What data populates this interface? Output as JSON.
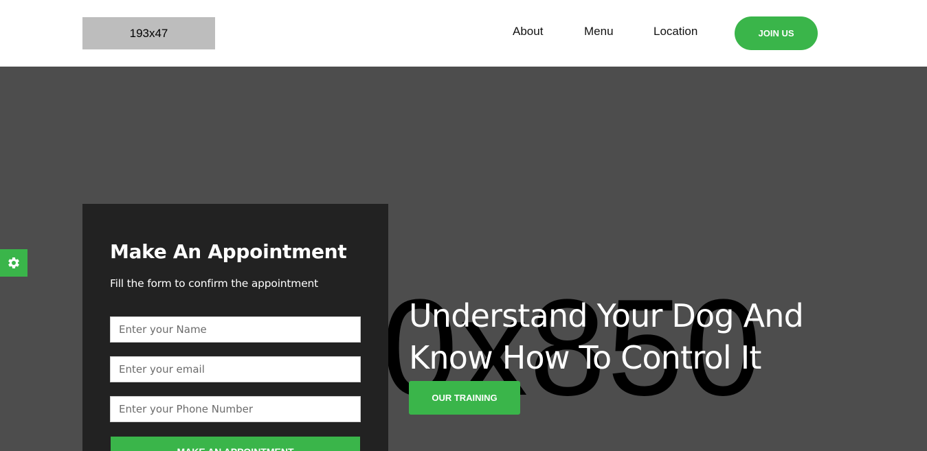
{
  "header": {
    "logo_text": "193x47",
    "nav": {
      "about": "About",
      "menu": "Menu",
      "location": "Location"
    },
    "join_label": "JOIN US"
  },
  "hero": {
    "placeholder_text": "0x850",
    "heading_line1": "Understand Your Dog And",
    "heading_line2": "Know How To Control It",
    "training_label": "OUR TRAINING"
  },
  "settings": {
    "icon": "gear-icon"
  },
  "appointment": {
    "title": "Make An Appointment",
    "subtitle": "Fill the form to confirm the appointment",
    "name_placeholder": "Enter your Name",
    "email_placeholder": "Enter your email",
    "phone_placeholder": "Enter your Phone Number",
    "submit_label": "MAKE AN APPOINTMENT"
  },
  "colors": {
    "accent": "#3ab54a",
    "hero_bg": "#4d4d4d",
    "card_bg": "#222222",
    "header_bg": "#ffffff",
    "logo_placeholder_bg": "#bdbdbd"
  }
}
